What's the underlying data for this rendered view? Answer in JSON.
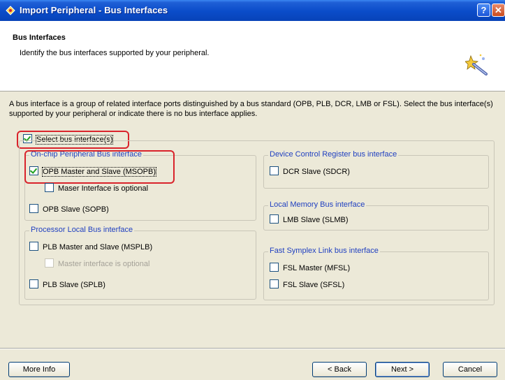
{
  "window": {
    "title": "Import Peripheral - Bus Interfaces",
    "help_glyph": "?",
    "close_glyph": "✕"
  },
  "header": {
    "title": "Bus Interfaces",
    "subtitle": "Identify the bus interfaces supported by your peripheral."
  },
  "description": "A bus interface is a group of related interface ports distinguished by a bus standard (OPB, PLB, DCR, LMB or FSL). Select the bus interface(s) supported by your peripheral or indicate there is no bus interface applies.",
  "select_bus": {
    "label": "Select bus interface(s)",
    "checked": true
  },
  "groups": {
    "opb": {
      "legend": "On-chip Peripheral Bus interface",
      "master_slave": {
        "label": "OPB Master and Slave (MSOPB)",
        "checked": true
      },
      "master_optional": {
        "label": "Maser Interface is optional",
        "checked": false
      },
      "slave": {
        "label": "OPB Slave (SOPB)",
        "checked": false
      }
    },
    "plb": {
      "legend": "Processor Local Bus interface",
      "master_slave": {
        "label": "PLB Master and Slave (MSPLB)",
        "checked": false
      },
      "master_optional": {
        "label": "Master interface is optional",
        "checked": false,
        "enabled": false
      },
      "slave": {
        "label": "PLB Slave (SPLB)",
        "checked": false
      }
    },
    "dcr": {
      "legend": "Device Control Register bus interface",
      "slave": {
        "label": "DCR Slave (SDCR)",
        "checked": false
      }
    },
    "lmb": {
      "legend": "Local Memory Bus interface",
      "slave": {
        "label": "LMB Slave (SLMB)",
        "checked": false
      }
    },
    "fsl": {
      "legend": "Fast Symplex Link bus interface",
      "master": {
        "label": "FSL Master (MFSL)",
        "checked": false
      },
      "slave": {
        "label": "FSL Slave (SFSL)",
        "checked": false
      }
    }
  },
  "buttons": {
    "more_info": "More Info",
    "back": "< Back",
    "next": "Next >",
    "cancel": "Cancel"
  },
  "colors": {
    "titlebar": "#0a4cc9",
    "legend_text": "#1f3fc0",
    "highlight_red": "#d9232b",
    "check_green": "#21a121"
  },
  "icons": {
    "app": "peripheral-app-icon",
    "wizard": "wizard-wand-icon"
  }
}
